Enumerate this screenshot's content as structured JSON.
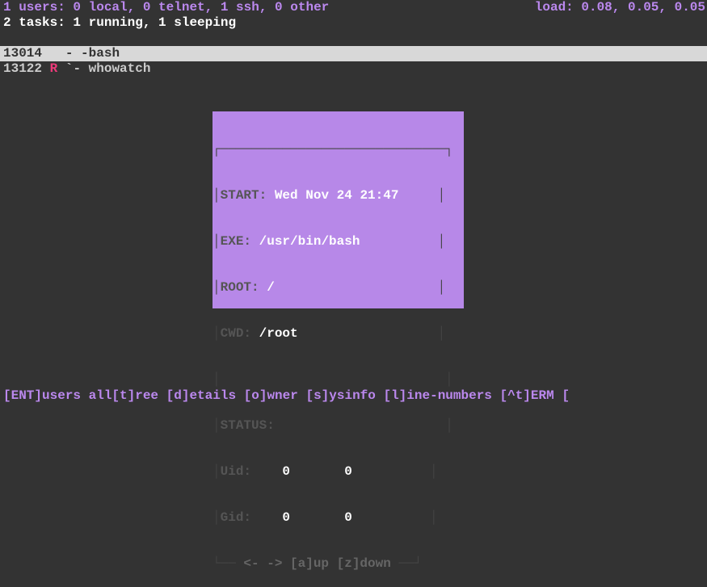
{
  "header": {
    "users_line": "1 users: 0 local, 0 telnet, 1 ssh, 0 other",
    "load_line": "load: 0.08, 0.05, 0.05",
    "tasks_line": "2 tasks: 1 running, 1 sleeping"
  },
  "processes": [
    {
      "pid": "13014",
      "state": " ",
      "tree": " - ",
      "command": "-bash",
      "selected": true
    },
    {
      "pid": "13122",
      "state": "R",
      "tree": " `- ",
      "command": "whowatch",
      "selected": false
    }
  ],
  "popup": {
    "start_label": "START:",
    "start_value": "Wed Nov 24 21:47",
    "exe_label": "EXE:",
    "exe_value": "/usr/bin/bash",
    "root_label": "ROOT:",
    "root_value": "/",
    "cwd_label": "CWD:",
    "cwd_value": "/root",
    "status_label": "STATUS:",
    "uid_label": "Uid:",
    "uid_v1": "0",
    "uid_v2": "0",
    "gid_label": "Gid:",
    "gid_v1": "0",
    "gid_v2": "0",
    "nav_text": "<- -> [a]up [z]down"
  },
  "footer": {
    "text": "[ENT]users all[t]ree [d]etails [o]wner [s]ysinfo [l]ine-numbers [^t]ERM ["
  }
}
